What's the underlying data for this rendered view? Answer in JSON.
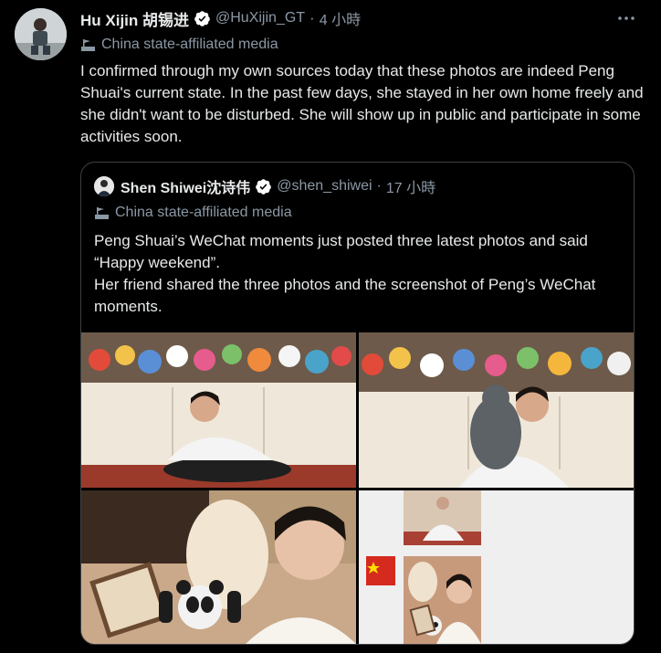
{
  "tweet": {
    "author_name": "Hu Xijin 胡锡进",
    "handle": "@HuXijin_GT",
    "separator": "·",
    "time": "4 小時",
    "affiliation": "China state-affiliated media",
    "text": "I confirmed through my own sources today that these photos are indeed Peng Shuai's current state. In the past few days, she stayed in her own home freely and she didn't want to be disturbed. She will show up in public and participate in some activities soon."
  },
  "quoted": {
    "author_name": "Shen Shiwei沈诗伟",
    "handle": "@shen_shiwei",
    "separator": "·",
    "time": "17 小時",
    "affiliation": "China state-affiliated media",
    "text_line1": "Peng Shuai’s WeChat moments just posted three latest photos and said “Happy weekend”.",
    "text_line2": "Her friend shared the three photos and the screenshot of Peng’s WeChat moments."
  },
  "icons": {
    "verified": "verified-badge-icon",
    "more": "more-options-icon",
    "affiliation": "state-media-flag-icon"
  },
  "colors": {
    "background": "#000000",
    "text": "#e7e9ea",
    "muted": "#8b98a5",
    "verified": "#ffffff",
    "border": "#3e4144"
  }
}
